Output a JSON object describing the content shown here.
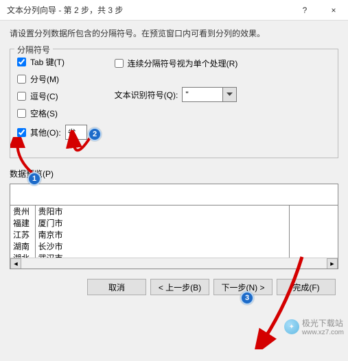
{
  "titlebar": {
    "title": "文本分列向导 - 第 2 步，共 3 步",
    "help_symbol": "?",
    "close_symbol": "×"
  },
  "instruction": "请设置分列数据所包含的分隔符号。在预览窗口内可看到分列的效果。",
  "delimiters": {
    "legend": "分隔符号",
    "tab_label": "Tab 键(T)",
    "semicolon_label": "分号(M)",
    "comma_label": "逗号(C)",
    "space_label": "空格(S)",
    "other_label": "其他(O):",
    "other_value": "省",
    "consecutive_label": "连续分隔符号视为单个处理(R)",
    "text_qualifier_label": "文本识别符号(Q):",
    "text_qualifier_value": "\""
  },
  "preview": {
    "label": "数据预览(P)",
    "rows": [
      [
        "贵州",
        "贵阳市"
      ],
      [
        "福建",
        "厦门市"
      ],
      [
        "江苏",
        "南京市"
      ],
      [
        "湖南",
        "长沙市"
      ],
      [
        "湖北",
        "武汉市"
      ]
    ]
  },
  "buttons": {
    "cancel": "取消",
    "back": "< 上一步(B)",
    "next": "下一步(N) >",
    "finish": "完成(F)"
  },
  "watermark": {
    "text": "极光下载站",
    "url": "www.xz7.com"
  },
  "annotations": {
    "n1": "1",
    "n2": "2",
    "n3": "3"
  }
}
